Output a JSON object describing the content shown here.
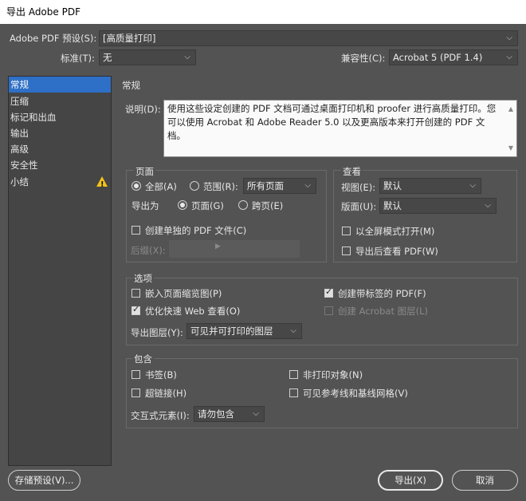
{
  "window": {
    "title": "导出 Adobe PDF"
  },
  "preset": {
    "label": "Adobe PDF 预设(S):",
    "value": "[高质量打印]"
  },
  "standard": {
    "label": "标准(T):",
    "value": "无"
  },
  "compatibility": {
    "label": "兼容性(C):",
    "value": "Acrobat 5 (PDF 1.4)"
  },
  "sidebar": {
    "items": [
      {
        "label": "常规"
      },
      {
        "label": "压缩"
      },
      {
        "label": "标记和出血"
      },
      {
        "label": "输出"
      },
      {
        "label": "高级"
      },
      {
        "label": "安全性"
      },
      {
        "label": "小结"
      }
    ]
  },
  "main": {
    "section_title": "常规",
    "description_label": "说明(D):",
    "description_text": "使用这些设定创建的 PDF 文档可通过桌面打印机和 proofer 进行高质量打印。您可以使用 Acrobat 和 Adobe Reader 5.0 以及更高版本来打开创建的 PDF 文档。"
  },
  "pages": {
    "title": "页面",
    "all_label": "全部(A)",
    "range_label": "范围(R):",
    "range_value": "所有页面",
    "export_as_label": "导出为",
    "pages_label": "页面(G)",
    "spreads_label": "跨页(E)",
    "separate_pdf_label": "创建单独的 PDF 文件(C)",
    "suffix_label": "后缀(X):"
  },
  "view": {
    "title": "查看",
    "view_label": "视图(E):",
    "view_value": "默认",
    "layout_label": "版面(U):",
    "layout_value": "默认",
    "fullscreen_label": "以全屏模式打开(M)",
    "view_after_label": "导出后查看 PDF(W)"
  },
  "options": {
    "title": "选项",
    "embed_thumbs_label": "嵌入页面缩览图(P)",
    "tagged_pdf_label": "创建带标签的 PDF(F)",
    "fast_web_label": "优化快速 Web 查看(O)",
    "acrobat_layers_label": "创建 Acrobat 图层(L)",
    "export_layers_label": "导出图层(Y):",
    "export_layers_value": "可见并可打印的图层"
  },
  "include": {
    "title": "包含",
    "bookmarks_label": "书签(B)",
    "nonprinting_label": "非打印对象(N)",
    "hyperlinks_label": "超链接(H)",
    "guides_label": "可见参考线和基线网格(V)",
    "interactive_label": "交互式元素(I):",
    "interactive_value": "请勿包含"
  },
  "footer": {
    "save_preset_label": "存储预设(V)...",
    "export_label": "导出(X)",
    "cancel_label": "取消"
  }
}
